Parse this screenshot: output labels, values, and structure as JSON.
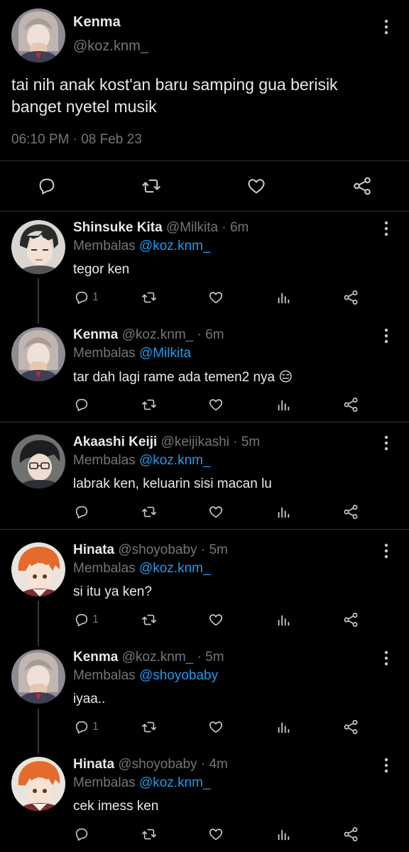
{
  "colors": {
    "background": "#000000",
    "text": "#e7e9ea",
    "muted": "#71767b",
    "accent": "#1d9bf0",
    "divider": "#2f3336"
  },
  "main_tweet": {
    "name": "Kenma",
    "handle": "@koz.knm_",
    "text_line1": "tai nih anak kost'an baru samping gua berisik",
    "text_line2": "banget nyetel musik",
    "timestamp": "06:10 PM · 08 Feb 23",
    "actions": [
      "reply-icon",
      "retweet-icon",
      "like-icon",
      "share-icon"
    ]
  },
  "replies": [
    {
      "name": "Shinsuke Kita",
      "handle": "@Milkita",
      "time": "· 6m",
      "replying_label": "Membalas",
      "replying_to": "@koz.knm_",
      "text": "tegor ken",
      "reply_count": "1",
      "emoji": ""
    },
    {
      "name": "Kenma",
      "handle": "@koz.knm_",
      "time": "· 6m",
      "replying_label": "Membalas",
      "replying_to": "@Milkita",
      "text": "tar dah lagi rame ada temen2 nya",
      "reply_count": "",
      "emoji": "😑"
    },
    {
      "name": "Akaashi Keiji",
      "handle": "@keijikashi",
      "time": "· 5m",
      "replying_label": "Membalas",
      "replying_to": "@koz.knm_",
      "text": "labrak ken, keluarin sisi macan lu",
      "reply_count": "",
      "emoji": ""
    },
    {
      "name": "Hinata",
      "handle": "@shoyobaby",
      "time": "· 5m",
      "replying_label": "Membalas",
      "replying_to": "@koz.knm_",
      "text": "si itu ya ken?",
      "reply_count": "1",
      "emoji": ""
    },
    {
      "name": "Kenma",
      "handle": "@koz.knm_",
      "time": "· 5m",
      "replying_label": "Membalas",
      "replying_to": "@shoyobaby",
      "text": "iyaa..",
      "reply_count": "1",
      "emoji": ""
    },
    {
      "name": "Hinata",
      "handle": "@shoyobaby",
      "time": "· 4m",
      "replying_label": "Membalas",
      "replying_to": "@koz.knm_",
      "text": "cek imess ken",
      "reply_count": "",
      "emoji": ""
    }
  ]
}
